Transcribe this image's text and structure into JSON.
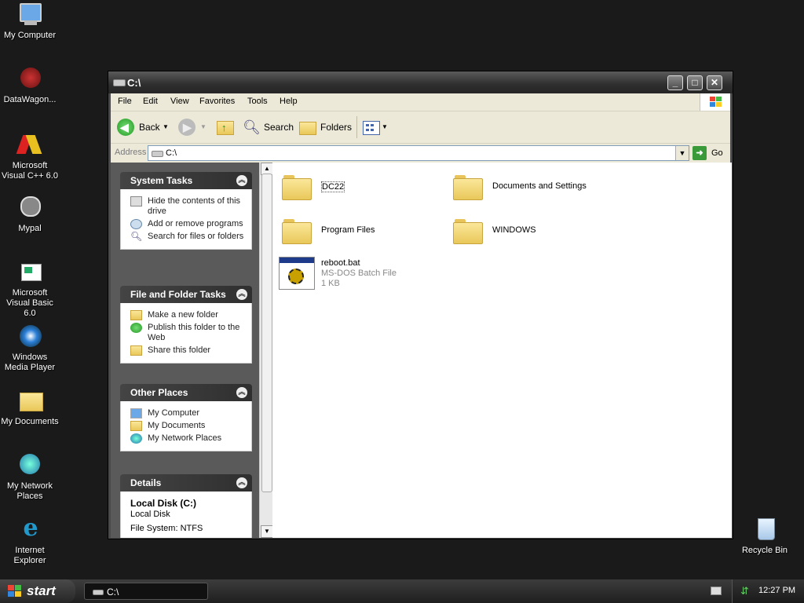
{
  "desktop": {
    "icons": [
      {
        "label": "My Computer"
      },
      {
        "label": "DataWagon..."
      },
      {
        "label": "Microsoft Visual C++ 6.0"
      },
      {
        "label": "Mypal"
      },
      {
        "label": "Microsoft Visual Basic 6.0"
      },
      {
        "label": "Windows Media Player"
      },
      {
        "label": "My Documents"
      },
      {
        "label": "My Network Places"
      },
      {
        "label": "Internet Explorer"
      },
      {
        "label": "Recycle Bin"
      }
    ]
  },
  "window": {
    "title": "C:\\",
    "menu": [
      "File",
      "Edit",
      "View",
      "Favorites",
      "Tools",
      "Help"
    ],
    "toolbar": {
      "back": "Back",
      "search": "Search",
      "folders": "Folders"
    },
    "address": {
      "label": "Address",
      "value": "C:\\",
      "go": "Go"
    }
  },
  "taskpane": {
    "system_tasks": {
      "title": "System Tasks",
      "items": [
        "Hide the contents of this drive",
        "Add or remove programs",
        "Search for files or folders"
      ]
    },
    "file_folder_tasks": {
      "title": "File and Folder Tasks",
      "items": [
        "Make a new folder",
        "Publish this folder to the Web",
        "Share this folder"
      ]
    },
    "other_places": {
      "title": "Other Places",
      "items": [
        "My Computer",
        "My Documents",
        "My Network Places"
      ]
    },
    "details": {
      "title": "Details",
      "name": "Local Disk (C:)",
      "type": "Local Disk",
      "filesystem": "File System: NTFS"
    }
  },
  "files": [
    {
      "name": "DC22",
      "kind": "folder"
    },
    {
      "name": "Documents and Settings",
      "kind": "folder"
    },
    {
      "name": "Program Files",
      "kind": "folder"
    },
    {
      "name": "WINDOWS",
      "kind": "folder"
    },
    {
      "name": "reboot.bat",
      "kind": "batch",
      "type": "MS-DOS Batch File",
      "size": "1 KB"
    }
  ],
  "taskbar": {
    "start": "start",
    "task_label": "C:\\",
    "clock": "12:27 PM"
  }
}
